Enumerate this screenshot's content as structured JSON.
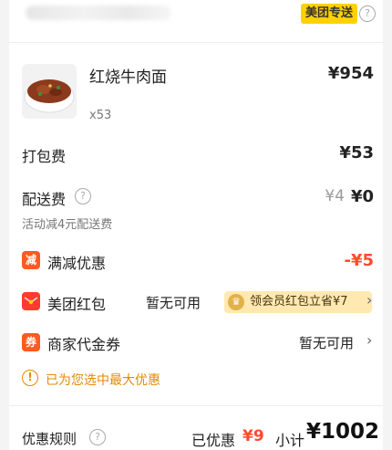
{
  "header": {
    "delivery_badge": "美团专送",
    "help_icon": "question-circle-icon",
    "help_glyph": "?"
  },
  "item": {
    "name": "红烧牛肉面",
    "quantity": "x53",
    "price": "¥954",
    "image_icon": "beef-noodle-bowl-image"
  },
  "packing": {
    "label": "打包费",
    "price": "¥53"
  },
  "delivery_fee": {
    "label": "配送费",
    "help_glyph": "?",
    "original_price": "¥4",
    "price": "¥0",
    "note": "活动减4元配送费"
  },
  "discount": {
    "icon_text": "减",
    "label": "满减优惠",
    "value": "-¥5"
  },
  "red_packet": {
    "icon": "red-envelope-icon",
    "label": "美团红包",
    "status": "暂无可用",
    "vip_icon": "crown-icon",
    "vip_offer": "领会员红包立省¥7",
    "chevron": "›"
  },
  "voucher": {
    "icon_text": "券",
    "label": "商家代金券",
    "status": "暂无可用",
    "chevron": "›"
  },
  "best_notice": {
    "icon": "exclamation-circle-icon",
    "glyph": "!",
    "text": "已为您选中最大优惠"
  },
  "footer": {
    "rules_label": "优惠规则",
    "help_glyph": "?",
    "saved_label": "已优惠",
    "saved_value": "¥9",
    "subtotal_label": "小计",
    "subtotal_value": "¥1002"
  },
  "colors": {
    "accent_yellow": "#ffd100",
    "discount_red": "#ff4b2b",
    "notice_orange": "#e58a00"
  }
}
